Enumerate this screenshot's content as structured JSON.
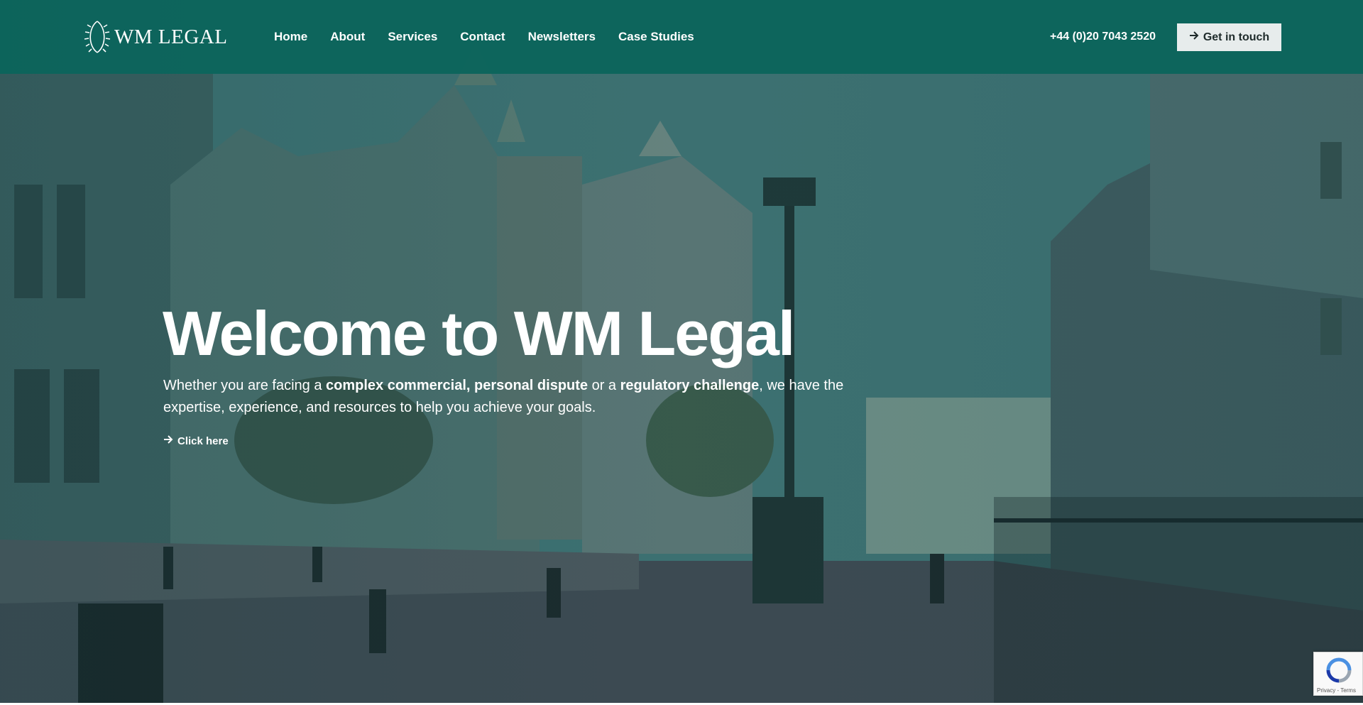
{
  "header": {
    "logo_text": "WM LEGAL",
    "nav": [
      "Home",
      "About",
      "Services",
      "Contact",
      "Newsletters",
      "Case Studies"
    ],
    "phone": "+44 (0)20 7043 2520",
    "cta_label": "Get in touch"
  },
  "hero": {
    "headline": "Welcome to WM Legal",
    "sub_parts": [
      "Whether you are facing a ",
      "complex commercial, personal dispute",
      " or a ",
      "regulatory challenge",
      ", we have the expertise, experience, and resources to help you achieve your goals."
    ],
    "link_label": "Click here"
  },
  "recaptcha": {
    "terms": "Privacy - Terms"
  },
  "colors": {
    "header_bg": "#0a645a",
    "accent_teal": "#0f6b60",
    "cta_bg": "#e7ecec"
  },
  "icons": [
    "laurel-logo-icon",
    "arrow-right-icon",
    "recaptcha-icon"
  ]
}
